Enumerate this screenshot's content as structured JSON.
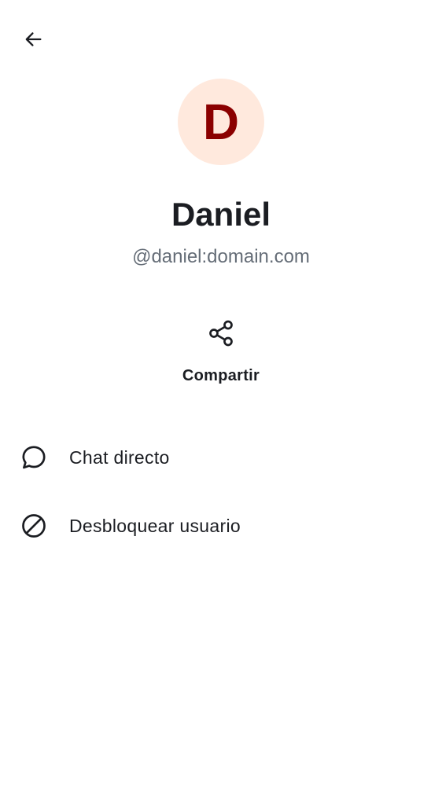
{
  "header": {
    "back_icon": "arrow-left-icon"
  },
  "profile": {
    "avatar_initial": "D",
    "avatar_bg_color": "#ffe9dd",
    "avatar_text_color": "#8b0000",
    "display_name": "Daniel",
    "user_id": "@daniel:domain.com"
  },
  "actions": {
    "share": {
      "icon": "share-icon",
      "label": "Compartir"
    }
  },
  "menu": {
    "items": [
      {
        "icon": "chat-bubble-icon",
        "label": "Chat directo"
      },
      {
        "icon": "block-icon",
        "label": "Desbloquear usuario"
      }
    ]
  },
  "colors": {
    "primary_text": "#1b1d22",
    "secondary_text": "#656d77",
    "background": "#ffffff"
  }
}
